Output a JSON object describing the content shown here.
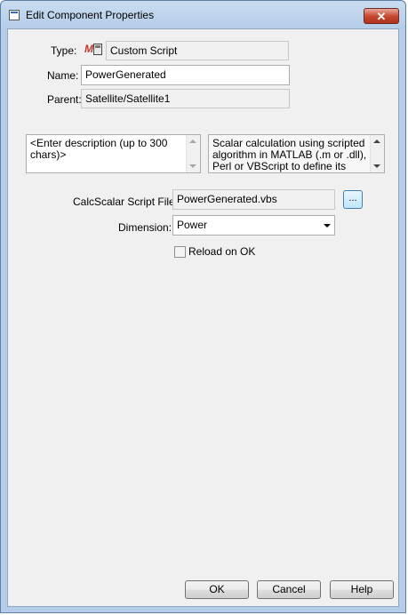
{
  "window": {
    "title": "Edit Component Properties",
    "close_label": "✕"
  },
  "form": {
    "type_label": "Type:",
    "type_value": "Custom Script",
    "name_label": "Name:",
    "name_value": "PowerGenerated",
    "parent_label": "Parent:",
    "parent_value": "Satellite/Satellite1",
    "description_placeholder": "<Enter description (up to 300 chars)>",
    "help_text": "Scalar calculation using scripted algorithm in MATLAB (.m or .dll), Perl or VBScript to define its value and",
    "script_file_label": "CalcScalar Script File:",
    "script_file_value": "PowerGenerated.vbs",
    "browse_label": "...",
    "dimension_label": "Dimension:",
    "dimension_value": "Power",
    "reload_label": "Reload on OK",
    "reload_checked": false
  },
  "buttons": {
    "ok": "OK",
    "cancel": "Cancel",
    "help": "Help"
  }
}
